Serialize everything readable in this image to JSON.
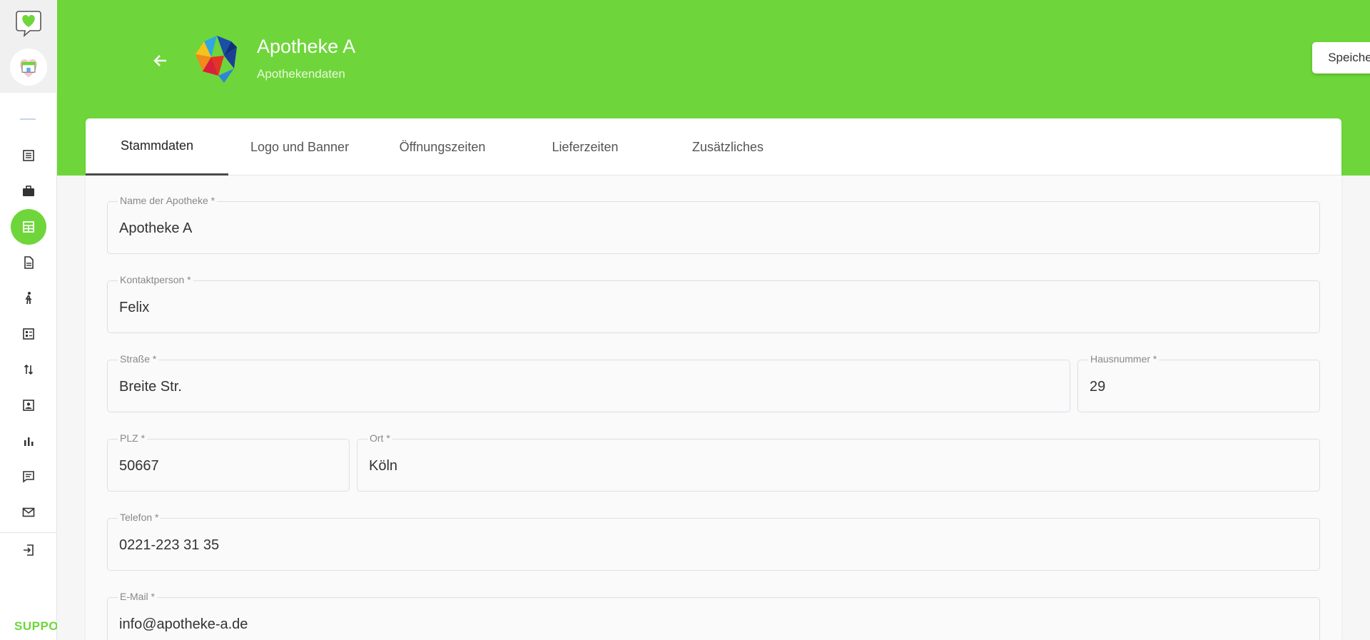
{
  "header": {
    "title": "Apotheke A",
    "subtitle": "Apothekendaten",
    "save_label": "Speichern"
  },
  "sidebar": {
    "support_label": "SUPPO",
    "items": [
      {
        "icon": "list-icon"
      },
      {
        "icon": "briefcase-icon"
      },
      {
        "icon": "store-icon",
        "active": true
      },
      {
        "icon": "document-icon"
      },
      {
        "icon": "walking-person-icon"
      },
      {
        "icon": "checklist-icon"
      },
      {
        "icon": "swap-vertical-icon"
      },
      {
        "icon": "contact-card-icon"
      },
      {
        "icon": "bar-chart-icon"
      },
      {
        "icon": "chat-icon"
      },
      {
        "icon": "mail-icon"
      },
      {
        "icon": "logout-icon"
      }
    ]
  },
  "tabs": [
    "Stammdaten",
    "Logo und Banner",
    "Öffnungszeiten",
    "Lieferzeiten",
    "Zusätzliches"
  ],
  "form": {
    "name": {
      "label": "Name der Apotheke *",
      "value": "Apotheke A"
    },
    "contact": {
      "label": "Kontaktperson *",
      "value": "Felix"
    },
    "street": {
      "label": "Straße *",
      "value": "Breite Str."
    },
    "housenumber": {
      "label": "Hausnummer *",
      "value": "29"
    },
    "zip": {
      "label": "PLZ *",
      "value": "50667"
    },
    "city": {
      "label": "Ort *",
      "value": "Köln"
    },
    "phone": {
      "label": "Telefon *",
      "value": "0221-223 31 35"
    },
    "email": {
      "label": "E-Mail *",
      "value": "info@apotheke-a.de"
    }
  },
  "colors": {
    "accent": "#6ed63a",
    "active_tab_underline": "#4a4a4a"
  }
}
